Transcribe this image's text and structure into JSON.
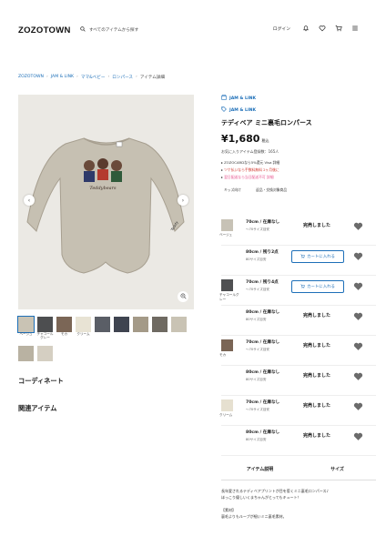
{
  "header": {
    "logo": "ZOZOTOWN",
    "search_placeholder": "すべてのアイテムから探す",
    "login": "ログイン"
  },
  "breadcrumb": [
    "ZOZOTOWN",
    "JAM & LINK",
    "ママ&ベビー",
    "ロンパース",
    "アイテム詳細"
  ],
  "product": {
    "brand": "JAM & LINK",
    "brand_shop": "JAM & LINK",
    "title": "テディベア ミニ裏毛ロンパース",
    "price": "¥1,680",
    "price_tax": "税込",
    "fav_count": "お気に入りアイテム登録数：165人",
    "promo": [
      {
        "text": "ZOZOCARDなら5%還元 Visa 詳細"
      },
      {
        "text": "ツケ払いなら手数料無料 2ヶ月後に"
      },
      {
        "text": "翌日配送なら当日配送不可 詳細"
      }
    ],
    "tags": [
      "キッズ向け",
      "返品・交換対象商品"
    ]
  },
  "thumbnails": {
    "row1": [
      {
        "label": "ベージュ",
        "color": "#c9c3b4"
      },
      {
        "label": "チャコールグレー",
        "color": "#4d4e50"
      },
      {
        "label": "モカ",
        "color": "#7b6656"
      },
      {
        "label": "クリーム",
        "color": "#e8e3d4"
      },
      {
        "label": "",
        "color": "#5a5e66"
      },
      {
        "label": "",
        "color": "#3f4450"
      },
      {
        "label": "",
        "color": "#a49a88"
      },
      {
        "label": "",
        "color": "#6f6a62"
      },
      {
        "label": "",
        "color": "#c9c3b4"
      }
    ],
    "row2": [
      {
        "label": "",
        "color": "#b9b2a2"
      },
      {
        "label": "",
        "color": "#d5cfc2"
      }
    ]
  },
  "sections": {
    "coordinate": "コーディネート",
    "related": "関連アイテム"
  },
  "skus": [
    {
      "color": "ベージュ",
      "swatch": "#c7c2b6",
      "rows": [
        {
          "size": "70cm / 在庫なし",
          "stock": "〜70サイズ目安",
          "status": "完売しました"
        },
        {
          "size": "80cm / 残り2点",
          "stock": "80サイズ目安",
          "status": "カートに入れる"
        }
      ]
    },
    {
      "color": "チャコールグレー",
      "swatch": "#4f5052",
      "rows": [
        {
          "size": "70cm / 残り4点",
          "stock": "〜70サイズ目安",
          "status": "カートに入れる"
        },
        {
          "size": "80cm / 在庫なし",
          "stock": "80サイズ目安",
          "status": "完売しました"
        }
      ]
    },
    {
      "color": "モカ",
      "swatch": "#7a6555",
      "rows": [
        {
          "size": "70cm / 在庫なし",
          "stock": "〜70サイズ目安",
          "status": "完売しました"
        },
        {
          "size": "80cm / 在庫なし",
          "stock": "80サイズ目安",
          "status": "完売しました"
        }
      ]
    },
    {
      "color": "クリーム",
      "swatch": "#e6e0d0",
      "rows": [
        {
          "size": "70cm / 在庫なし",
          "stock": "〜70サイズ目安",
          "status": "完売しました"
        },
        {
          "size": "80cm / 在庫なし",
          "stock": "80サイズ目安",
          "status": "完売しました"
        }
      ]
    }
  ],
  "description": {
    "tabs": [
      "アイテム説明",
      "サイズ"
    ],
    "lines": [
      "長年愛されるテディベアプリントが目を惹くミニ裏毛ロンパース♪",
      "ほっこり優しいくまちゃんがとってもキュート！",
      "",
      "【素材】",
      "裏毛よりもループが細いミニ裏毛素材。"
    ]
  },
  "colors": {
    "link": "#1d6fb8",
    "heart": "#6b6b6b",
    "accent_red": "#d0342c"
  }
}
